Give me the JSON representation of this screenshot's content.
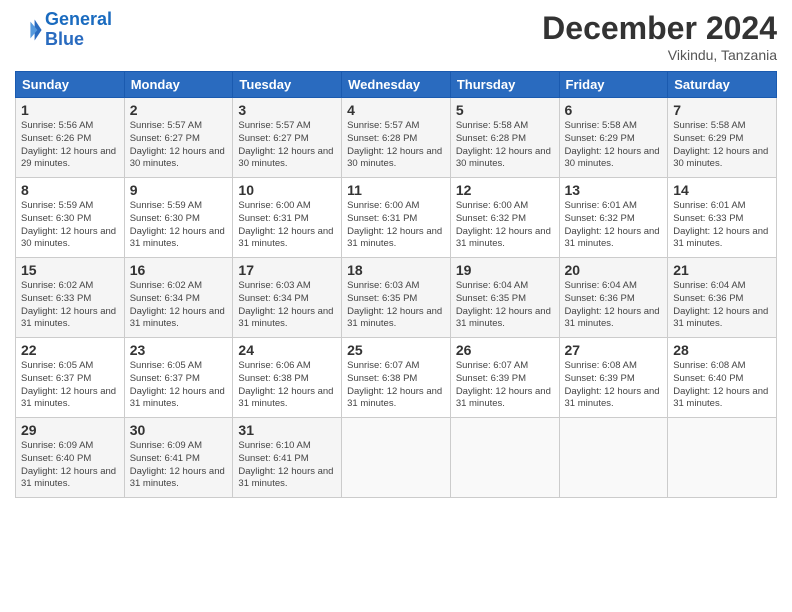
{
  "header": {
    "logo_line1": "General",
    "logo_line2": "Blue",
    "month_title": "December 2024",
    "location": "Vikindu, Tanzania"
  },
  "days_of_week": [
    "Sunday",
    "Monday",
    "Tuesday",
    "Wednesday",
    "Thursday",
    "Friday",
    "Saturday"
  ],
  "weeks": [
    [
      {
        "day": "1",
        "sunrise": "5:56 AM",
        "sunset": "6:26 PM",
        "daylight": "12 hours and 29 minutes."
      },
      {
        "day": "2",
        "sunrise": "5:57 AM",
        "sunset": "6:27 PM",
        "daylight": "12 hours and 30 minutes."
      },
      {
        "day": "3",
        "sunrise": "5:57 AM",
        "sunset": "6:27 PM",
        "daylight": "12 hours and 30 minutes."
      },
      {
        "day": "4",
        "sunrise": "5:57 AM",
        "sunset": "6:28 PM",
        "daylight": "12 hours and 30 minutes."
      },
      {
        "day": "5",
        "sunrise": "5:58 AM",
        "sunset": "6:28 PM",
        "daylight": "12 hours and 30 minutes."
      },
      {
        "day": "6",
        "sunrise": "5:58 AM",
        "sunset": "6:29 PM",
        "daylight": "12 hours and 30 minutes."
      },
      {
        "day": "7",
        "sunrise": "5:58 AM",
        "sunset": "6:29 PM",
        "daylight": "12 hours and 30 minutes."
      }
    ],
    [
      {
        "day": "8",
        "sunrise": "5:59 AM",
        "sunset": "6:30 PM",
        "daylight": "12 hours and 30 minutes."
      },
      {
        "day": "9",
        "sunrise": "5:59 AM",
        "sunset": "6:30 PM",
        "daylight": "12 hours and 31 minutes."
      },
      {
        "day": "10",
        "sunrise": "6:00 AM",
        "sunset": "6:31 PM",
        "daylight": "12 hours and 31 minutes."
      },
      {
        "day": "11",
        "sunrise": "6:00 AM",
        "sunset": "6:31 PM",
        "daylight": "12 hours and 31 minutes."
      },
      {
        "day": "12",
        "sunrise": "6:00 AM",
        "sunset": "6:32 PM",
        "daylight": "12 hours and 31 minutes."
      },
      {
        "day": "13",
        "sunrise": "6:01 AM",
        "sunset": "6:32 PM",
        "daylight": "12 hours and 31 minutes."
      },
      {
        "day": "14",
        "sunrise": "6:01 AM",
        "sunset": "6:33 PM",
        "daylight": "12 hours and 31 minutes."
      }
    ],
    [
      {
        "day": "15",
        "sunrise": "6:02 AM",
        "sunset": "6:33 PM",
        "daylight": "12 hours and 31 minutes."
      },
      {
        "day": "16",
        "sunrise": "6:02 AM",
        "sunset": "6:34 PM",
        "daylight": "12 hours and 31 minutes."
      },
      {
        "day": "17",
        "sunrise": "6:03 AM",
        "sunset": "6:34 PM",
        "daylight": "12 hours and 31 minutes."
      },
      {
        "day": "18",
        "sunrise": "6:03 AM",
        "sunset": "6:35 PM",
        "daylight": "12 hours and 31 minutes."
      },
      {
        "day": "19",
        "sunrise": "6:04 AM",
        "sunset": "6:35 PM",
        "daylight": "12 hours and 31 minutes."
      },
      {
        "day": "20",
        "sunrise": "6:04 AM",
        "sunset": "6:36 PM",
        "daylight": "12 hours and 31 minutes."
      },
      {
        "day": "21",
        "sunrise": "6:04 AM",
        "sunset": "6:36 PM",
        "daylight": "12 hours and 31 minutes."
      }
    ],
    [
      {
        "day": "22",
        "sunrise": "6:05 AM",
        "sunset": "6:37 PM",
        "daylight": "12 hours and 31 minutes."
      },
      {
        "day": "23",
        "sunrise": "6:05 AM",
        "sunset": "6:37 PM",
        "daylight": "12 hours and 31 minutes."
      },
      {
        "day": "24",
        "sunrise": "6:06 AM",
        "sunset": "6:38 PM",
        "daylight": "12 hours and 31 minutes."
      },
      {
        "day": "25",
        "sunrise": "6:07 AM",
        "sunset": "6:38 PM",
        "daylight": "12 hours and 31 minutes."
      },
      {
        "day": "26",
        "sunrise": "6:07 AM",
        "sunset": "6:39 PM",
        "daylight": "12 hours and 31 minutes."
      },
      {
        "day": "27",
        "sunrise": "6:08 AM",
        "sunset": "6:39 PM",
        "daylight": "12 hours and 31 minutes."
      },
      {
        "day": "28",
        "sunrise": "6:08 AM",
        "sunset": "6:40 PM",
        "daylight": "12 hours and 31 minutes."
      }
    ],
    [
      {
        "day": "29",
        "sunrise": "6:09 AM",
        "sunset": "6:40 PM",
        "daylight": "12 hours and 31 minutes."
      },
      {
        "day": "30",
        "sunrise": "6:09 AM",
        "sunset": "6:41 PM",
        "daylight": "12 hours and 31 minutes."
      },
      {
        "day": "31",
        "sunrise": "6:10 AM",
        "sunset": "6:41 PM",
        "daylight": "12 hours and 31 minutes."
      },
      null,
      null,
      null,
      null
    ]
  ]
}
